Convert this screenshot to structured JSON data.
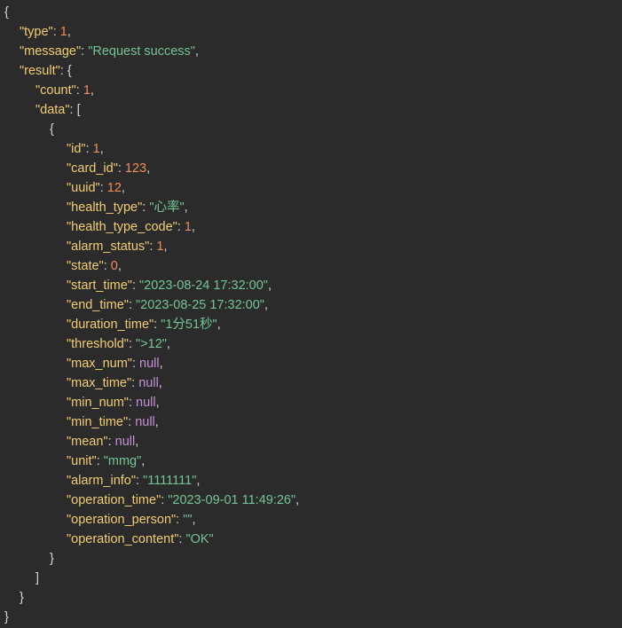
{
  "lines": [
    {
      "indent": 0,
      "tokens": [
        {
          "t": "{",
          "c": "p"
        }
      ]
    },
    {
      "indent": 1,
      "tokens": [
        {
          "t": "\"type\"",
          "c": "k"
        },
        {
          "t": ": ",
          "c": "p"
        },
        {
          "t": "1",
          "c": "n"
        },
        {
          "t": ",",
          "c": "p"
        }
      ]
    },
    {
      "indent": 1,
      "tokens": [
        {
          "t": "\"message\"",
          "c": "k"
        },
        {
          "t": ": ",
          "c": "p"
        },
        {
          "t": "\"Request success\"",
          "c": "s"
        },
        {
          "t": ",",
          "c": "p"
        }
      ]
    },
    {
      "indent": 1,
      "tokens": [
        {
          "t": "\"result\"",
          "c": "k"
        },
        {
          "t": ": {",
          "c": "p"
        }
      ]
    },
    {
      "indent": 2,
      "tokens": [
        {
          "t": "\"count\"",
          "c": "k"
        },
        {
          "t": ": ",
          "c": "p"
        },
        {
          "t": "1",
          "c": "n"
        },
        {
          "t": ",",
          "c": "p"
        }
      ]
    },
    {
      "indent": 2,
      "tokens": [
        {
          "t": "\"data\"",
          "c": "k"
        },
        {
          "t": ": [",
          "c": "p"
        }
      ]
    },
    {
      "indent": 3,
      "tokens": [
        {
          "t": "{",
          "c": "p"
        }
      ]
    },
    {
      "indent": 4,
      "tokens": [
        {
          "t": "\"id\"",
          "c": "k"
        },
        {
          "t": ": ",
          "c": "p"
        },
        {
          "t": "1",
          "c": "n"
        },
        {
          "t": ",",
          "c": "p"
        }
      ]
    },
    {
      "indent": 4,
      "tokens": [
        {
          "t": "\"card_id\"",
          "c": "k"
        },
        {
          "t": ": ",
          "c": "p"
        },
        {
          "t": "123",
          "c": "n"
        },
        {
          "t": ",",
          "c": "p"
        }
      ]
    },
    {
      "indent": 4,
      "tokens": [
        {
          "t": "\"uuid\"",
          "c": "k"
        },
        {
          "t": ": ",
          "c": "p"
        },
        {
          "t": "12",
          "c": "n"
        },
        {
          "t": ",",
          "c": "p"
        }
      ]
    },
    {
      "indent": 4,
      "tokens": [
        {
          "t": "\"health_type\"",
          "c": "k"
        },
        {
          "t": ": ",
          "c": "p"
        },
        {
          "t": "\"心率\"",
          "c": "s"
        },
        {
          "t": ",",
          "c": "p"
        }
      ]
    },
    {
      "indent": 4,
      "tokens": [
        {
          "t": "\"health_type_code\"",
          "c": "k"
        },
        {
          "t": ": ",
          "c": "p"
        },
        {
          "t": "1",
          "c": "n"
        },
        {
          "t": ",",
          "c": "p"
        }
      ]
    },
    {
      "indent": 4,
      "tokens": [
        {
          "t": "\"alarm_status\"",
          "c": "k"
        },
        {
          "t": ": ",
          "c": "p"
        },
        {
          "t": "1",
          "c": "n"
        },
        {
          "t": ",",
          "c": "p"
        }
      ]
    },
    {
      "indent": 4,
      "tokens": [
        {
          "t": "\"state\"",
          "c": "k"
        },
        {
          "t": ": ",
          "c": "p"
        },
        {
          "t": "0",
          "c": "n"
        },
        {
          "t": ",",
          "c": "p"
        }
      ]
    },
    {
      "indent": 4,
      "tokens": [
        {
          "t": "\"start_time\"",
          "c": "k"
        },
        {
          "t": ": ",
          "c": "p"
        },
        {
          "t": "\"2023-08-24 17:32:00\"",
          "c": "s"
        },
        {
          "t": ",",
          "c": "p"
        }
      ]
    },
    {
      "indent": 4,
      "tokens": [
        {
          "t": "\"end_time\"",
          "c": "k"
        },
        {
          "t": ": ",
          "c": "p"
        },
        {
          "t": "\"2023-08-25 17:32:00\"",
          "c": "s"
        },
        {
          "t": ",",
          "c": "p"
        }
      ]
    },
    {
      "indent": 4,
      "tokens": [
        {
          "t": "\"duration_time\"",
          "c": "k"
        },
        {
          "t": ": ",
          "c": "p"
        },
        {
          "t": "\"1分51秒\"",
          "c": "s"
        },
        {
          "t": ",",
          "c": "p"
        }
      ]
    },
    {
      "indent": 4,
      "tokens": [
        {
          "t": "\"threshold\"",
          "c": "k"
        },
        {
          "t": ": ",
          "c": "p"
        },
        {
          "t": "\">12\"",
          "c": "s"
        },
        {
          "t": ",",
          "c": "p"
        }
      ]
    },
    {
      "indent": 4,
      "tokens": [
        {
          "t": "\"max_num\"",
          "c": "k"
        },
        {
          "t": ": ",
          "c": "p"
        },
        {
          "t": "null",
          "c": "nl"
        },
        {
          "t": ",",
          "c": "p"
        }
      ]
    },
    {
      "indent": 4,
      "tokens": [
        {
          "t": "\"max_time\"",
          "c": "k"
        },
        {
          "t": ": ",
          "c": "p"
        },
        {
          "t": "null",
          "c": "nl"
        },
        {
          "t": ",",
          "c": "p"
        }
      ]
    },
    {
      "indent": 4,
      "tokens": [
        {
          "t": "\"min_num\"",
          "c": "k"
        },
        {
          "t": ": ",
          "c": "p"
        },
        {
          "t": "null",
          "c": "nl"
        },
        {
          "t": ",",
          "c": "p"
        }
      ]
    },
    {
      "indent": 4,
      "tokens": [
        {
          "t": "\"min_time\"",
          "c": "k"
        },
        {
          "t": ": ",
          "c": "p"
        },
        {
          "t": "null",
          "c": "nl"
        },
        {
          "t": ",",
          "c": "p"
        }
      ]
    },
    {
      "indent": 4,
      "tokens": [
        {
          "t": "\"mean\"",
          "c": "k"
        },
        {
          "t": ": ",
          "c": "p"
        },
        {
          "t": "null",
          "c": "nl"
        },
        {
          "t": ",",
          "c": "p"
        }
      ]
    },
    {
      "indent": 4,
      "tokens": [
        {
          "t": "\"unit\"",
          "c": "k"
        },
        {
          "t": ": ",
          "c": "p"
        },
        {
          "t": "\"mmg\"",
          "c": "s"
        },
        {
          "t": ",",
          "c": "p"
        }
      ]
    },
    {
      "indent": 4,
      "tokens": [
        {
          "t": "\"alarm_info\"",
          "c": "k"
        },
        {
          "t": ": ",
          "c": "p"
        },
        {
          "t": "\"1111111\"",
          "c": "s"
        },
        {
          "t": ",",
          "c": "p"
        }
      ]
    },
    {
      "indent": 4,
      "tokens": [
        {
          "t": "\"operation_time\"",
          "c": "k"
        },
        {
          "t": ": ",
          "c": "p"
        },
        {
          "t": "\"2023-09-01 11:49:26\"",
          "c": "s"
        },
        {
          "t": ",",
          "c": "p"
        }
      ]
    },
    {
      "indent": 4,
      "tokens": [
        {
          "t": "\"operation_person\"",
          "c": "k"
        },
        {
          "t": ": ",
          "c": "p"
        },
        {
          "t": "\"\"",
          "c": "s"
        },
        {
          "t": ",",
          "c": "p"
        }
      ]
    },
    {
      "indent": 4,
      "tokens": [
        {
          "t": "\"operation_content\"",
          "c": "k"
        },
        {
          "t": ": ",
          "c": "p"
        },
        {
          "t": "\"OK\"",
          "c": "s"
        }
      ]
    },
    {
      "indent": 3,
      "tokens": [
        {
          "t": "}",
          "c": "p"
        }
      ]
    },
    {
      "indent": 2,
      "tokens": [
        {
          "t": "]",
          "c": "p"
        }
      ]
    },
    {
      "indent": 1,
      "tokens": [
        {
          "t": "}",
          "c": "p"
        }
      ]
    },
    {
      "indent": 0,
      "tokens": [
        {
          "t": "}",
          "c": "p"
        }
      ]
    }
  ],
  "colors": {
    "background": "#2b2b2b",
    "punctuation": "#d4d4d4",
    "key": "#f2cd75",
    "string": "#74c596",
    "number": "#f08d5e",
    "null": "#c48fd9"
  }
}
